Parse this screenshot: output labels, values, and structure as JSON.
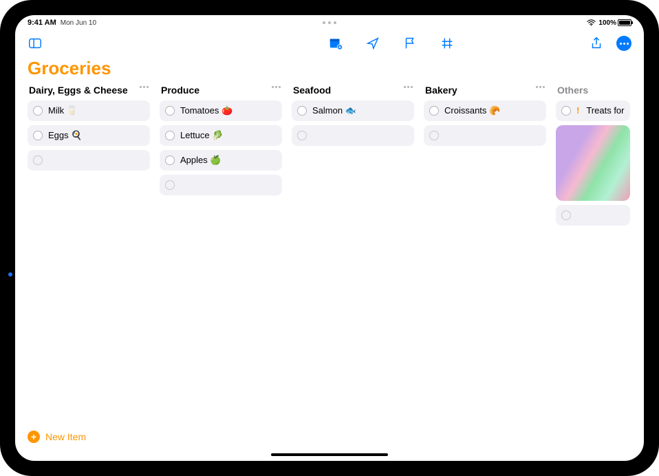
{
  "status": {
    "time": "9:41 AM",
    "date": "Mon Jun 10",
    "battery": "100%"
  },
  "title": "Groceries",
  "new_item_label": "New Item",
  "columns": [
    {
      "id": "dairy",
      "title": "Dairy, Eggs & Cheese",
      "items": [
        {
          "label": "Milk 🥛"
        },
        {
          "label": "Eggs 🍳"
        }
      ]
    },
    {
      "id": "produce",
      "title": "Produce",
      "items": [
        {
          "label": "Tomatoes 🍅"
        },
        {
          "label": "Lettuce 🥬"
        },
        {
          "label": "Apples 🍏"
        }
      ]
    },
    {
      "id": "seafood",
      "title": "Seafood",
      "items": [
        {
          "label": "Salmon 🐟"
        }
      ]
    },
    {
      "id": "bakery",
      "title": "Bakery",
      "items": [
        {
          "label": "Croissants 🥐"
        }
      ]
    },
    {
      "id": "others",
      "title": "Others",
      "items": [
        {
          "label": "Treats for",
          "priority": "!"
        }
      ]
    }
  ]
}
